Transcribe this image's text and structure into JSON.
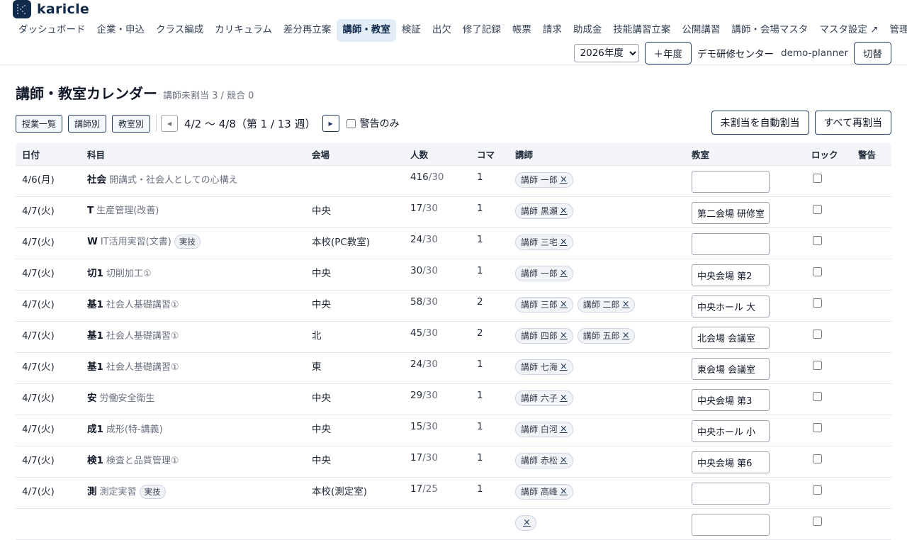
{
  "app": {
    "name": "karicle"
  },
  "nav": [
    "ダッシュボード",
    "企業・申込",
    "クラス編成",
    "カリキュラム",
    "差分再立案",
    "講師・教室",
    "検証",
    "出欠",
    "修了記録",
    "帳票",
    "請求",
    "助成金",
    "技能講習立案",
    "公開講習",
    "講師・会場マスタ",
    "マスタ設定 ↗",
    "管理"
  ],
  "nav_active": 5,
  "header": {
    "year": "2026年度",
    "add_year": "＋年度",
    "center": "デモ研修センター",
    "user": "demo-planner",
    "switch": "切替"
  },
  "page": {
    "title": "講師・教室カレンダー",
    "subtitle": "講師未割当 3 / 競合 0"
  },
  "controls": {
    "view_list": "授業一覧",
    "view_instructor": "講師別",
    "view_room": "教室別",
    "range": "4/2 〜 4/8（第 1 / 13 週）",
    "warn_only": "警告のみ",
    "auto_assign": "未割当を自動割当",
    "reassign_all": "すべて再割当"
  },
  "table": {
    "headers": [
      "日付",
      "科目",
      "会場",
      "人数",
      "コマ",
      "講師",
      "教室",
      "ロック",
      "警告"
    ],
    "rows": [
      {
        "date": "4/6(月)",
        "code": "社会",
        "name": "開講式・社会人としての心構え",
        "tag": "",
        "venue": "",
        "count": "416",
        "cap": "/30",
        "koma": "1",
        "instructors": [
          "講師 一郎"
        ],
        "room": ""
      },
      {
        "date": "4/7(火)",
        "code": "T",
        "name": "生産管理(改善)",
        "tag": "",
        "venue": "中央",
        "count": "17",
        "cap": "/30",
        "koma": "1",
        "instructors": [
          "講師 黒瀬"
        ],
        "room": "第二会場 研修室"
      },
      {
        "date": "4/7(火)",
        "code": "W",
        "name": "IT活用実習(文書)",
        "tag": "実技",
        "venue": "本校(PC教室)",
        "count": "24",
        "cap": "/30",
        "koma": "1",
        "instructors": [
          "講師 三宅"
        ],
        "room": ""
      },
      {
        "date": "4/7(火)",
        "code": "切1",
        "name": "切削加工①",
        "tag": "",
        "venue": "中央",
        "count": "30",
        "cap": "/30",
        "koma": "1",
        "instructors": [
          "講師 一郎"
        ],
        "room": "中央会場 第2"
      },
      {
        "date": "4/7(火)",
        "code": "基1",
        "name": "社会人基礎講習①",
        "tag": "",
        "venue": "中央",
        "count": "58",
        "cap": "/30",
        "koma": "2",
        "instructors": [
          "講師 三郎",
          "講師 二郎"
        ],
        "room": "中央ホール 大"
      },
      {
        "date": "4/7(火)",
        "code": "基1",
        "name": "社会人基礎講習①",
        "tag": "",
        "venue": "北",
        "count": "45",
        "cap": "/30",
        "koma": "2",
        "instructors": [
          "講師 四郎",
          "講師 五郎"
        ],
        "room": "北会場 会議室"
      },
      {
        "date": "4/7(火)",
        "code": "基1",
        "name": "社会人基礎講習①",
        "tag": "",
        "venue": "東",
        "count": "24",
        "cap": "/30",
        "koma": "1",
        "instructors": [
          "講師 七海"
        ],
        "room": "東会場 会議室"
      },
      {
        "date": "4/7(火)",
        "code": "安",
        "name": "労働安全衛生",
        "tag": "",
        "venue": "中央",
        "count": "29",
        "cap": "/30",
        "koma": "1",
        "instructors": [
          "講師 六子"
        ],
        "room": "中央会場 第3"
      },
      {
        "date": "4/7(火)",
        "code": "成1",
        "name": "成形(特-講義)",
        "tag": "",
        "venue": "中央",
        "count": "15",
        "cap": "/30",
        "koma": "1",
        "instructors": [
          "講師 白河"
        ],
        "room": "中央ホール 小"
      },
      {
        "date": "4/7(火)",
        "code": "検1",
        "name": "検査と品質管理①",
        "tag": "",
        "venue": "中央",
        "count": "17",
        "cap": "/30",
        "koma": "1",
        "instructors": [
          "講師 赤松"
        ],
        "room": "中央会場 第6"
      },
      {
        "date": "4/7(火)",
        "code": "測",
        "name": "測定実習",
        "tag": "実技",
        "venue": "本校(測定室)",
        "count": "17",
        "cap": "/25",
        "koma": "1",
        "instructors": [
          "講師 高峰"
        ],
        "room": ""
      },
      {
        "date": "",
        "code": "",
        "name": "",
        "tag": "",
        "venue": "",
        "count": "",
        "cap": "",
        "koma": "",
        "instructors": [
          ""
        ],
        "room": ""
      }
    ]
  }
}
